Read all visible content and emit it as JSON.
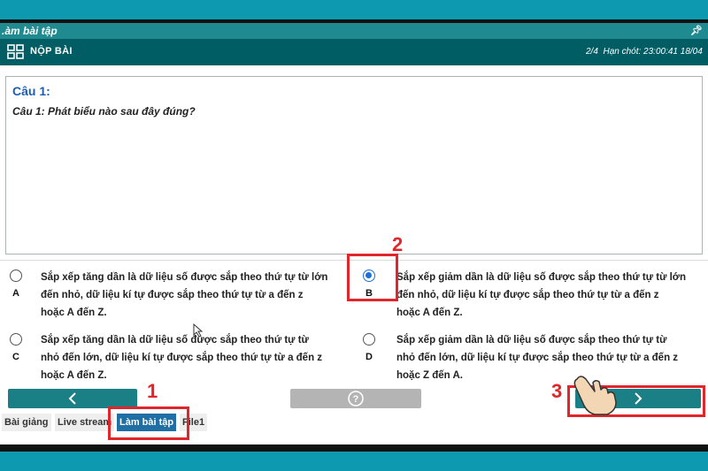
{
  "window": {
    "title": ".àm bài tập",
    "pin_icon": "pin-icon"
  },
  "toolbar": {
    "grid_icon": "grid-icon",
    "submit_label": "NỘP BÀI",
    "progress": "2/4",
    "deadline": "Hạn chót: 23:00:41 18/04"
  },
  "question": {
    "number": "Câu 1:",
    "text": "Câu 1: Phát biểu nào sau đây đúng?"
  },
  "answers": [
    {
      "letter": "A",
      "lines": [
        "Sắp xếp tăng dần là dữ liệu số được sắp theo thứ tự từ lớn",
        "đến nhỏ, dữ liệu kí tự được sắp theo thứ tự từ a đến z",
        "hoặc A đến Z."
      ],
      "selected": false
    },
    {
      "letter": "B",
      "lines": [
        "Sắp xếp giảm dần là dữ liệu số được sắp theo thứ tự từ lớn",
        "đến nhỏ, dữ liệu kí tự được sắp theo thứ tự từ a đến z",
        "hoặc A đến Z."
      ],
      "selected": true
    },
    {
      "letter": "C",
      "lines": [
        "Sắp xếp tăng dần là dữ liệu số được sắp theo thứ tự từ",
        "nhỏ đến lớn, dữ liệu kí tự được sắp theo thứ tự từ a đến z",
        "hoặc A đến Z."
      ],
      "selected": false
    },
    {
      "letter": "D",
      "lines": [
        "Sắp xếp giảm dần là dữ liệu số được sắp theo thứ tự từ",
        "nhỏ đến lớn, dữ liệu kí tự được sắp theo thứ tự từ a đến z",
        "hoặc Z đến A."
      ],
      "selected": false
    }
  ],
  "nav": {
    "prev_icon": "chevron-left-icon",
    "help_icon": "question-circle-icon",
    "next_icon": "chevron-right-icon"
  },
  "tabs": [
    {
      "label": "Bài giảng",
      "active": false
    },
    {
      "label": "Live stream",
      "active": false
    },
    {
      "label": "Làm bài tập",
      "active": true
    },
    {
      "label": "File1",
      "active": false
    }
  ],
  "annotations": {
    "step1": "1",
    "step2": "2",
    "step3": "3",
    "color": "#e0262a"
  },
  "colors": {
    "frame": "#0d9ab0",
    "toolbar": "#005d64",
    "titlebar": "#1f8a90",
    "accent": "#1b7f86",
    "question_blue": "#1e5cb3",
    "radio_selected": "#1e6fd9"
  }
}
